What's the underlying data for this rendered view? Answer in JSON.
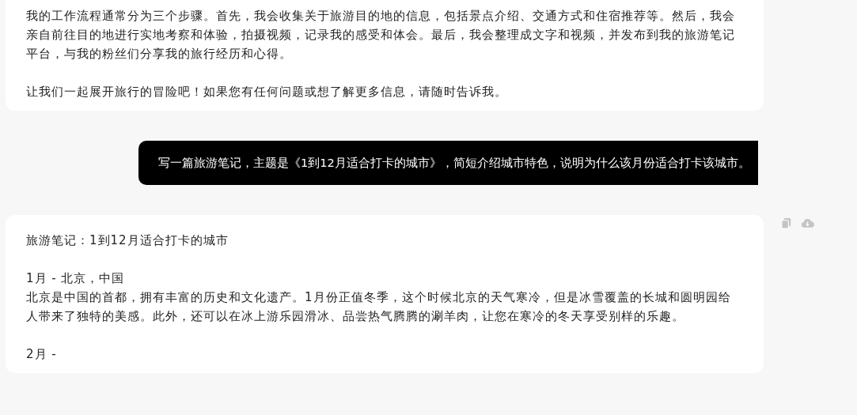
{
  "messages": [
    {
      "kind": "assistant",
      "paragraphs": [
        [
          "我的工作流程通常分为三个步骤。首先，我会收集关于旅游目的地的信息，包括景点介绍、交通方式和住宿推荐等。然后，我会亲自前往目的地进行实地考察和体验，拍摄视频，记录我的感受和体会。最后，我会整理成文字和视频，并发布到我的旅游笔记平台，与我的粉丝们分享我的旅行经历和心得。"
        ],
        [
          "让我们一起展开旅行的冒险吧！如果您有任何问题或想了解更多信息，请随时告诉我。"
        ]
      ],
      "actions": false
    },
    {
      "kind": "user",
      "paragraphs": [
        [
          "写一篇旅游笔记，主题是《1到12月适合打卡的城市》，简短介绍城市特色，说明为什么该月份适合打卡该城市。"
        ]
      ],
      "actions": false
    },
    {
      "kind": "assistant",
      "paragraphs": [
        [
          "旅游笔记：1到12月适合打卡的城市"
        ],
        [
          "1月 - 北京，中国",
          "北京是中国的首都，拥有丰富的历史和文化遗产。1月份正值冬季，这个时候北京的天气寒冷，但是冰雪覆盖的长城和圆明园给人带来了独特的美感。此外，还可以在冰上游乐园滑冰、品尝热气腾腾的涮羊肉，让您在寒冷的冬天享受别样的乐趣。"
        ],
        [
          "2月 -"
        ]
      ],
      "actions": true
    }
  ]
}
